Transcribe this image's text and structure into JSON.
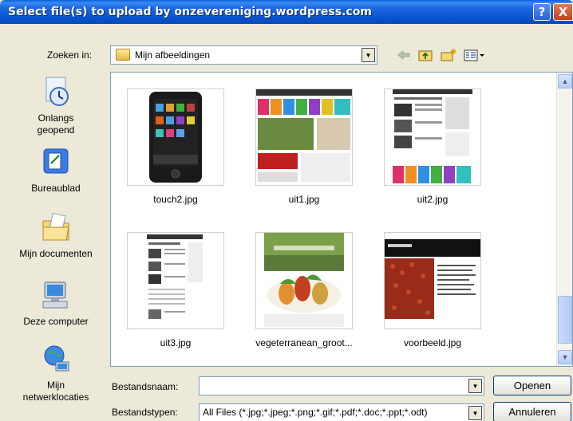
{
  "window": {
    "title": "Select file(s) to upload by onzevereniging.wordpress.com",
    "help_label": "?",
    "close_label": "X"
  },
  "lookin": {
    "label": "Zoeken in:",
    "value": "Mijn afbeeldingen"
  },
  "toolbar": {
    "back_icon": "back-arrow-icon",
    "up_icon": "up-folder-icon",
    "new_folder_icon": "new-folder-icon",
    "view_icon": "view-menu-icon"
  },
  "places": [
    {
      "label_line1": "Onlangs",
      "label_line2": "geopend",
      "icon": "recent-icon"
    },
    {
      "label_line1": "Bureaublad",
      "label_line2": "",
      "icon": "desktop-icon"
    },
    {
      "label_line1": "Mijn documenten",
      "label_line2": "",
      "icon": "my-documents-icon"
    },
    {
      "label_line1": "Deze computer",
      "label_line2": "",
      "icon": "my-computer-icon"
    },
    {
      "label_line1": "Mijn",
      "label_line2": "netwerklocaties",
      "icon": "network-places-icon"
    }
  ],
  "files": [
    {
      "name": "touch2.jpg"
    },
    {
      "name": "uit1.jpg"
    },
    {
      "name": "uit2.jpg"
    },
    {
      "name": "uit3.jpg"
    },
    {
      "name": "vegeterranean_groot..."
    },
    {
      "name": "voorbeeld.jpg"
    }
  ],
  "form": {
    "filename_label": "Bestandsnaam:",
    "filename_value": "",
    "filetype_label": "Bestandstypen:",
    "filetype_value": "All Files (*.jpg;*.jpeg;*.png;*.gif;*.pdf;*.doc;*.ppt;*.odt)",
    "open_label": "Openen",
    "cancel_label": "Annuleren"
  }
}
